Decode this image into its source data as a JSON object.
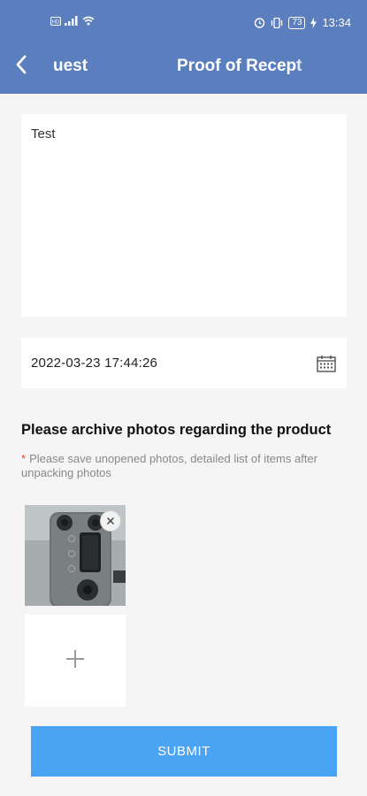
{
  "status_bar": {
    "left_icons": [
      "sim-hd-icon",
      "signal-icon",
      "wifi-icon"
    ],
    "right_icons": [
      "alarm-icon",
      "vibrate-icon"
    ],
    "battery": "73",
    "time": "13:34"
  },
  "nav": {
    "prev_title": "uest",
    "title": "Proof of Recept"
  },
  "form": {
    "note_value": "Test",
    "datetime_value": "2022-03-23 17:44:26",
    "photos_title": "Please archive photos regarding the product",
    "photos_hint": "Please save unopened photos, detailed list of items after unpacking photos",
    "required_mark": "*"
  },
  "actions": {
    "submit_label": "SUBMIT"
  },
  "colors": {
    "appbar": "#5b7fbe",
    "submit": "#4ba3f3",
    "required": "#e04a3b"
  }
}
